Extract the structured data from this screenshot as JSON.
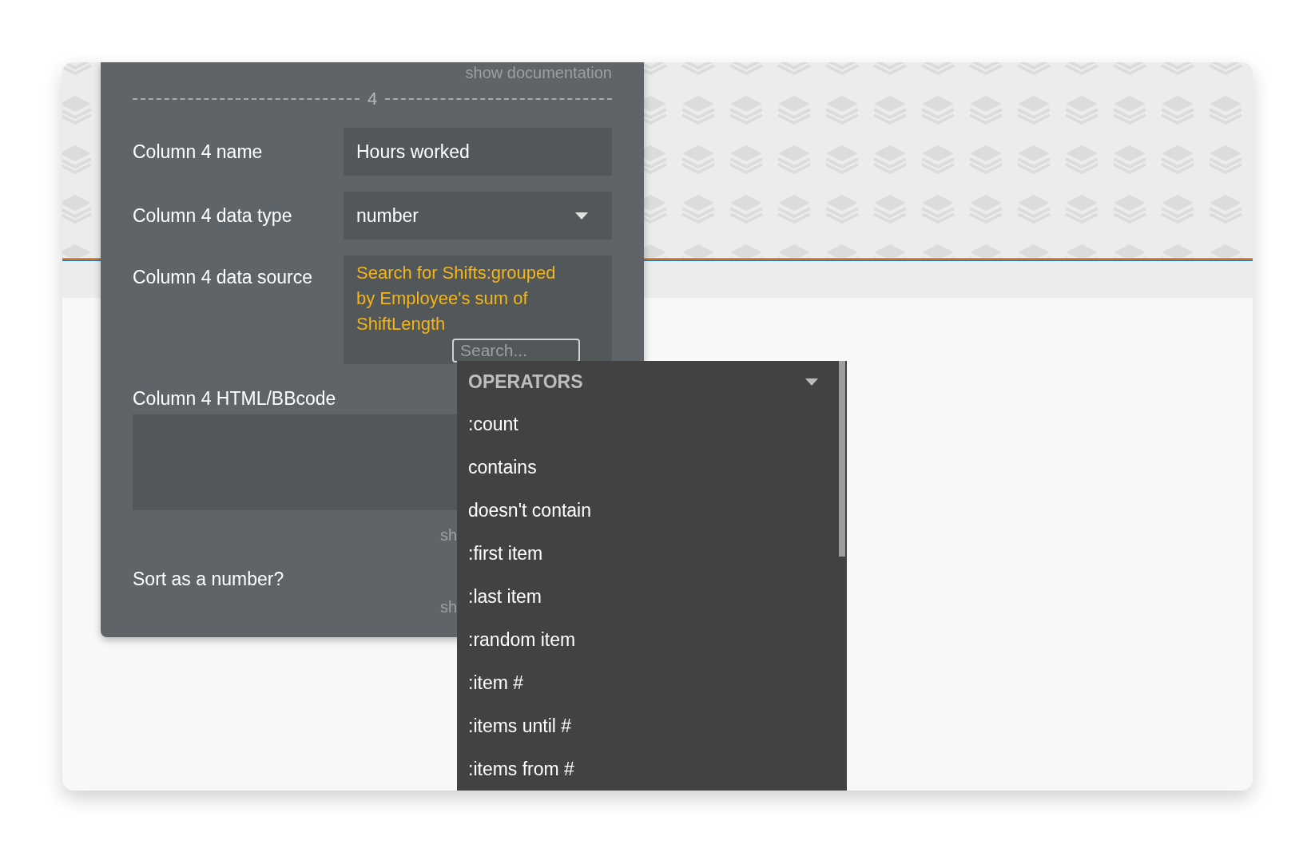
{
  "panel": {
    "doc_link_top": "show documentation",
    "section_divider": {
      "label": "4"
    },
    "fields": [
      {
        "kind": "text",
        "label": "Column 4 name",
        "value": "Hours worked"
      },
      {
        "kind": "select",
        "label": "Column 4 data type",
        "value": "number"
      },
      {
        "kind": "expression",
        "label": "Column 4 data source",
        "value": "Search for Shifts:grouped by Employee's sum of ShiftLength",
        "search_placeholder": "Search..."
      },
      {
        "kind": "textarea",
        "label": "Column 4 HTML/BBcode",
        "doc_link": "sh"
      },
      {
        "kind": "checkbox",
        "label": "Sort as a number?",
        "doc_link": "sh"
      }
    ]
  },
  "dropdown": {
    "header": "OPERATORS",
    "items": [
      ":count",
      "contains",
      "doesn't contain",
      ":first item",
      ":last item",
      ":random item",
      ":item #",
      ":items until #",
      ":items from #"
    ]
  }
}
